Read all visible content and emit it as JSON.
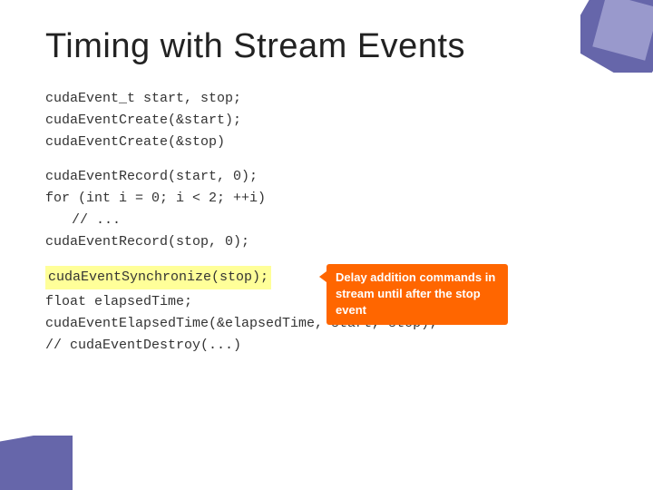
{
  "page": {
    "title": "Timing with Stream Events",
    "background": "#ffffff"
  },
  "code": {
    "section1": [
      "cudaEvent_t start, stop;",
      "cudaEventCreate(&start);",
      "cudaEventCreate(&stop)"
    ],
    "section2": [
      "cudaEventRecord(start, 0);",
      "for (int i = 0; i < 2; ++i)",
      "  // ...",
      "cudaEventRecord(stop, 0);"
    ],
    "highlighted_line": "cudaEventSynchronize(stop);",
    "section3": [
      "float elapsedTime;",
      "cudaEventElapsedTime(&elapsedTime, start, stop);",
      "// cudaEventDestroy(...)"
    ]
  },
  "tooltip": {
    "text": "Delay addition commands in stream until after the stop event"
  }
}
